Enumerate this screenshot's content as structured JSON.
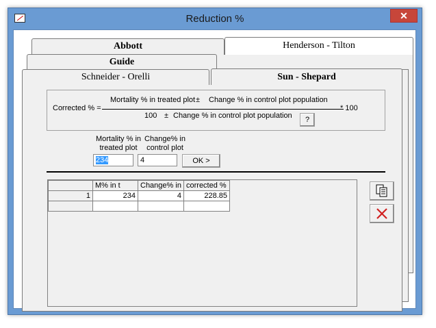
{
  "window": {
    "title": "Reduction %",
    "close_glyph": "✕"
  },
  "tabs": {
    "row_back": [
      "Abbott",
      "Henderson - Tilton"
    ],
    "row_mid": [
      "Guide"
    ],
    "row_front": [
      "Schneider - Orelli",
      "Sun - Shepard"
    ],
    "active": "Sun - Shepard"
  },
  "formula": {
    "lhs": "Corrected % =",
    "numerator_a": "Mortality % in treated plot",
    "pm1": "±",
    "numerator_b": "Change % in control plot population",
    "denominator_a": "100",
    "pm2": "±",
    "denominator_b": "Change % in control plot population",
    "multiplier": "* 100",
    "help_label": "?"
  },
  "inputs": {
    "mortality_label_1": "Mortality % in",
    "mortality_label_2": "treated plot",
    "change_label_1": "Change% in",
    "change_label_2": "control plot",
    "mortality_value": "234",
    "change_value": "4",
    "ok_label": "OK >"
  },
  "grid": {
    "headers": [
      "",
      "M% in t",
      "Change% in",
      "corrected %"
    ],
    "rows": [
      [
        "1",
        "234",
        "4",
        "228.85"
      ],
      [
        "",
        "",
        "",
        ""
      ]
    ]
  },
  "icons": {
    "copy": "copy-icon",
    "delete": "delete-icon"
  },
  "colors": {
    "titlebar": "#6a9bd3",
    "close": "#c7463a",
    "selection": "#3399ff",
    "delete_x": "#d02020"
  }
}
